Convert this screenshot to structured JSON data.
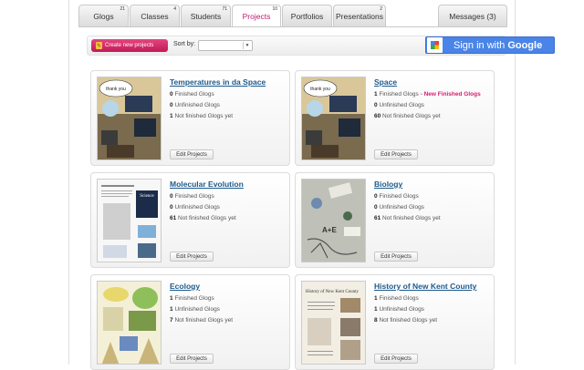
{
  "tabs": [
    {
      "label": "Glogs",
      "count": "21"
    },
    {
      "label": "Classes",
      "count": "4"
    },
    {
      "label": "Students",
      "count": "71"
    },
    {
      "label": "Projects",
      "count": "10"
    },
    {
      "label": "Portfolios",
      "count": ""
    },
    {
      "label": "Presentations",
      "count": "2"
    }
  ],
  "messages_tab": "Messages (3)",
  "toolbar": {
    "create_label": "Create new projects",
    "sort_label": "Sort by:",
    "sort_value": ""
  },
  "google": {
    "prefix": "Sign in with ",
    "brand": "Google"
  },
  "projects": [
    {
      "title": "Temperatures in da Space",
      "finished": "0",
      "finished_label": "Finished Glogs",
      "unfinished": "0",
      "unfinished_label": "Unfinished Glogs",
      "notfinished": "1",
      "notfinished_label": "Not finished Glogs yet",
      "badge": "",
      "edit": "Edit Projects",
      "thumb_text": "thank you"
    },
    {
      "title": "Space",
      "finished": "1",
      "finished_label": "Finished Glogs",
      "unfinished": "0",
      "unfinished_label": "Unfinished Glogs",
      "notfinished": "60",
      "notfinished_label": "Not finished Glogs yet",
      "badge": "- New Finished Glogs",
      "edit": "Edit Projects",
      "thumb_text": "thank you"
    },
    {
      "title": "Molecular Evolution",
      "finished": "0",
      "finished_label": "Finished Glogs",
      "unfinished": "0",
      "unfinished_label": "Unfinished Glogs",
      "notfinished": "61",
      "notfinished_label": "Not finished Glogs yet",
      "badge": "",
      "edit": "Edit Projects",
      "thumb_text": "Science"
    },
    {
      "title": "Biology",
      "finished": "0",
      "finished_label": "Finished Glogs",
      "unfinished": "0",
      "unfinished_label": "Unfinished Glogs",
      "notfinished": "61",
      "notfinished_label": "Not finished Glogs yet",
      "badge": "",
      "edit": "Edit Projects",
      "thumb_text": "A+E"
    },
    {
      "title": "Ecology",
      "finished": "1",
      "finished_label": "Finished Glogs",
      "unfinished": "1",
      "unfinished_label": "Unfinished Glogs",
      "notfinished": "7",
      "notfinished_label": "Not finished Glogs yet",
      "badge": "",
      "edit": "Edit Projects",
      "thumb_text": ""
    },
    {
      "title": "History of New Kent County",
      "finished": "1",
      "finished_label": "Finished Glogs",
      "unfinished": "1",
      "unfinished_label": "Unfinished Glogs",
      "notfinished": "8",
      "notfinished_label": "Not finished Glogs yet",
      "badge": "",
      "edit": "Edit Projects",
      "thumb_text": "History of New Kent County"
    }
  ],
  "colors": {
    "accent": "#c0186f",
    "link": "#1d5a8c",
    "google": "#4a84e8"
  }
}
